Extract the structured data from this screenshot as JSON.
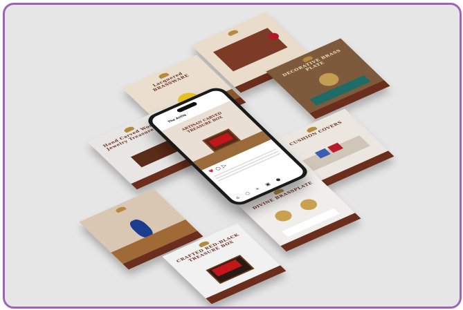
{
  "frame_color": "#9c63b8",
  "background_color": "#e6e6e6",
  "brand_color": "#6b2d1c",
  "phone": {
    "account": "The Antiq",
    "post_title": "ARTISAN CARVED TREASURE BOX",
    "actions": [
      "heart-icon",
      "comment-icon",
      "send-icon",
      "bookmark-icon"
    ],
    "nav_icons": [
      "home-icon",
      "search-icon",
      "add-icon",
      "reels-icon",
      "profile-icon"
    ]
  },
  "cards": [
    {
      "id": "review",
      "title": ""
    },
    {
      "id": "brassplate",
      "title": "DECORATIVE BRASS PLATE"
    },
    {
      "id": "lacquered",
      "title": "Lacquered BRASSWARE"
    },
    {
      "id": "cushion",
      "title": "CUSHION COVERS"
    },
    {
      "id": "jewelry-box",
      "title": "Hand Carved Wooden Jewelry Treasure Box"
    },
    {
      "id": "divine",
      "title": "DIVINE BRASSPLATE"
    },
    {
      "id": "vase",
      "title": ""
    },
    {
      "id": "treasure",
      "title": "CRAFTED RED-BLACK TREASURE BOX"
    }
  ]
}
